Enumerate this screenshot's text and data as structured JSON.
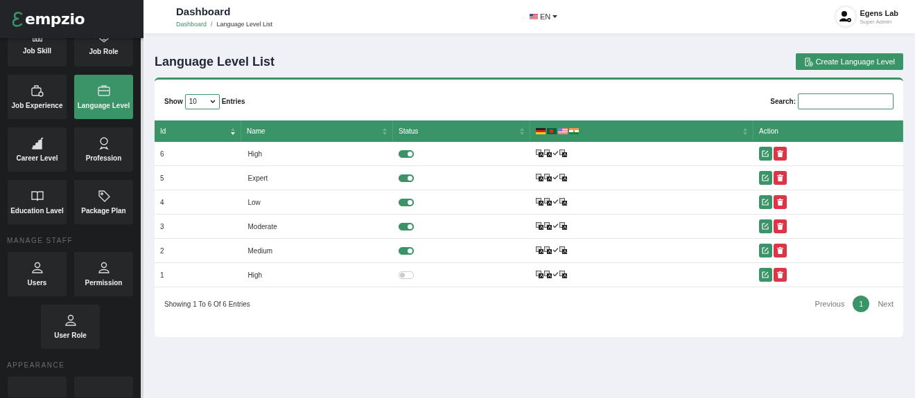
{
  "brand": {
    "name": "empzio"
  },
  "sidebar": {
    "sections": [
      {
        "items": [
          {
            "label": "Job Skill",
            "selected": false
          },
          {
            "label": "Job Role",
            "selected": false
          },
          {
            "label": "Job Experience",
            "selected": false
          },
          {
            "label": "Language Level",
            "selected": true
          },
          {
            "label": "Career Level",
            "selected": false
          },
          {
            "label": "Profession",
            "selected": false
          },
          {
            "label": "Education Lavel",
            "selected": false
          },
          {
            "label": "Package Plan",
            "selected": false
          }
        ]
      },
      {
        "title": "MANAGE STAFF",
        "items": [
          {
            "label": "Users",
            "selected": false
          },
          {
            "label": "Permission",
            "selected": false
          },
          {
            "label": "User Role",
            "selected": false
          }
        ]
      },
      {
        "title": "APPEARANCE"
      }
    ]
  },
  "header": {
    "title": "Dashboard",
    "breadcrumb_separator": "/",
    "breadcrumb": [
      {
        "label": "Dashboard",
        "kind": "link"
      },
      {
        "label": "Language Level List",
        "kind": "current"
      }
    ],
    "language": "EN",
    "user": {
      "name": "Egens Lab",
      "role": "Super Admin"
    }
  },
  "page": {
    "title": "Language Level List",
    "create_button": "Create Language Level"
  },
  "table": {
    "show_label": "Show",
    "page_size": "10",
    "entries_label": "Entries",
    "search_label": "Search:",
    "columns": [
      {
        "kind": "text",
        "label": "Id",
        "sortable": true,
        "sorted": true
      },
      {
        "kind": "text",
        "label": "Name",
        "sortable": true,
        "sorted": false
      },
      {
        "kind": "text",
        "label": "Status",
        "sortable": true,
        "sorted": false
      },
      {
        "kind": "flags",
        "sortable": true,
        "sorted": false
      },
      {
        "kind": "text",
        "label": "Action",
        "sortable": false
      }
    ],
    "rows": [
      {
        "id": "6",
        "name": "High",
        "active": true,
        "translated": [
          false,
          false,
          true,
          false
        ]
      },
      {
        "id": "5",
        "name": "Expert",
        "active": true,
        "translated": [
          false,
          false,
          true,
          false
        ]
      },
      {
        "id": "4",
        "name": "Low",
        "active": true,
        "translated": [
          false,
          false,
          true,
          false
        ]
      },
      {
        "id": "3",
        "name": "Moderate",
        "active": true,
        "translated": [
          false,
          false,
          true,
          false
        ]
      },
      {
        "id": "2",
        "name": "Medium",
        "active": true,
        "translated": [
          false,
          false,
          true,
          false
        ]
      },
      {
        "id": "1",
        "name": "High",
        "active": false,
        "translated": [
          false,
          false,
          true,
          false
        ]
      }
    ],
    "info": "Showing 1 To 6 Of 6 Entries",
    "pagination": {
      "previous": "Previous",
      "pages": [
        {
          "label": "1",
          "selected": true
        }
      ],
      "next": "Next"
    }
  }
}
